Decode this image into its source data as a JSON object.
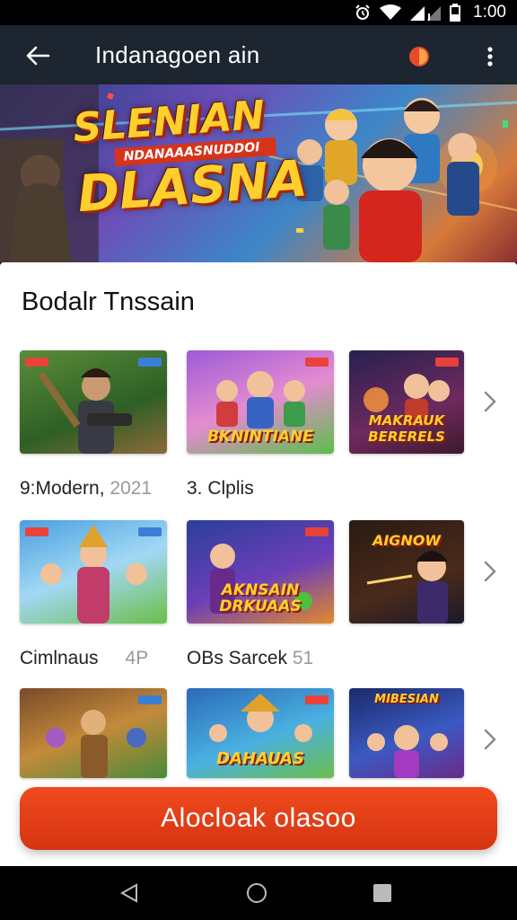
{
  "status_bar": {
    "time": "1:00",
    "icons": [
      "alarm-icon",
      "wifi-icon",
      "signal-icon",
      "battery-icon"
    ]
  },
  "app_bar": {
    "title": "Indanagoen ain",
    "icons": [
      "back-arrow-icon",
      "app-logo-icon",
      "more-vert-icon"
    ]
  },
  "banner": {
    "title_line1": "SLENIAN",
    "subtitle": "NDANAAASNUDDOI",
    "title_line2": "DLASNA"
  },
  "section": {
    "title": "Bodalr Tnssain"
  },
  "rows": [
    {
      "cards": [
        {
          "caption": ""
        },
        {
          "caption": "BKNINTIANE"
        },
        {
          "caption": "MAKRAUK BERERELS"
        }
      ],
      "labels": [
        {
          "text": "9:Modern, ",
          "muted": "2021"
        },
        {
          "text": "3. Clplis",
          "muted": ""
        }
      ]
    },
    {
      "cards": [
        {
          "caption": ""
        },
        {
          "caption": "AKNSAIN DRKUAAS"
        },
        {
          "caption": "AIGNOW"
        }
      ],
      "labels": [
        {
          "text": "Cimlnaus",
          "muted": "4P"
        },
        {
          "text": "OBs Sarcek ",
          "muted": "51"
        }
      ]
    },
    {
      "cards": [
        {
          "caption": ""
        },
        {
          "caption": "DAHAUAS"
        },
        {
          "caption": "MIBESIAN"
        }
      ],
      "labels": []
    }
  ],
  "cta": {
    "label": "Alocloak olasoo"
  },
  "colors": {
    "app_bar": "#1d2530",
    "accent": "#e03c16",
    "title_gold": "#ffcf2e"
  }
}
